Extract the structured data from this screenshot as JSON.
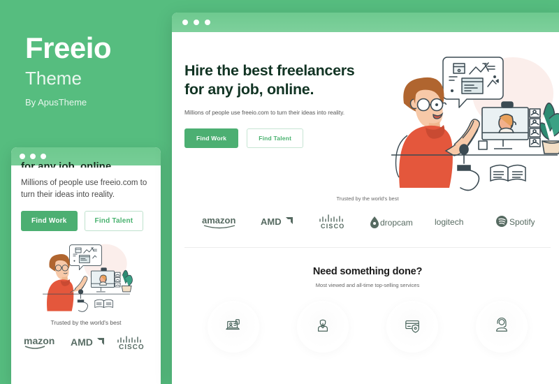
{
  "theme_colors": {
    "background_green": "#56bd7f",
    "chrome_green": "#6ec98f",
    "primary_button": "#4caf72",
    "ghost_button_text": "#49b26f",
    "heading_dark_green": "#123424",
    "icon_gray_green": "#47635a"
  },
  "brand": {
    "title": "Freeio",
    "subtitle": "Theme",
    "author": "By ApusTheme"
  },
  "window_controls": {
    "dots": [
      "close-dot",
      "minimize-dot",
      "maximize-dot"
    ]
  },
  "hero": {
    "heading_line1": "Hire the best freelancers",
    "heading_line2": "for any job, online.",
    "subtitle": "Millions of people use freeio.com to turn their ideas into reality.",
    "primary_button": "Find Work",
    "secondary_button": "Find Talent",
    "illustration_name": "video-call-freelancer-illustration"
  },
  "trusted": {
    "label": "Trusted by the world's best",
    "logos": [
      {
        "name": "amazon",
        "icon": "amazon-logo"
      },
      {
        "name": "AMD",
        "icon": "amd-logo"
      },
      {
        "name": "cisco",
        "icon": "cisco-logo"
      },
      {
        "name": "dropcam",
        "icon": "dropcam-logo"
      },
      {
        "name": "logitech",
        "icon": "logitech-logo"
      },
      {
        "name": "Spotify",
        "icon": "spotify-logo"
      }
    ]
  },
  "services_section": {
    "heading": "Need something done?",
    "subtitle": "Most viewed and all-time top-selling services",
    "items": [
      {
        "icon": "laptop-profile-icon"
      },
      {
        "icon": "freelancer-person-icon"
      },
      {
        "icon": "secure-payment-card-icon"
      },
      {
        "icon": "headset-support-icon"
      }
    ]
  },
  "mini_window": {
    "clipped_heading": "for any job, online.",
    "subtitle": "Millions of people use freeio.com to turn their ideas into reality.",
    "primary_button": "Find Work",
    "secondary_button": "Find Talent",
    "trusted_label": "Trusted by the world's best",
    "logos": [
      {
        "name": "amazon",
        "icon": "amazon-logo"
      },
      {
        "name": "AMD",
        "icon": "amd-logo"
      },
      {
        "name": "cisco",
        "icon": "cisco-logo"
      }
    ]
  }
}
